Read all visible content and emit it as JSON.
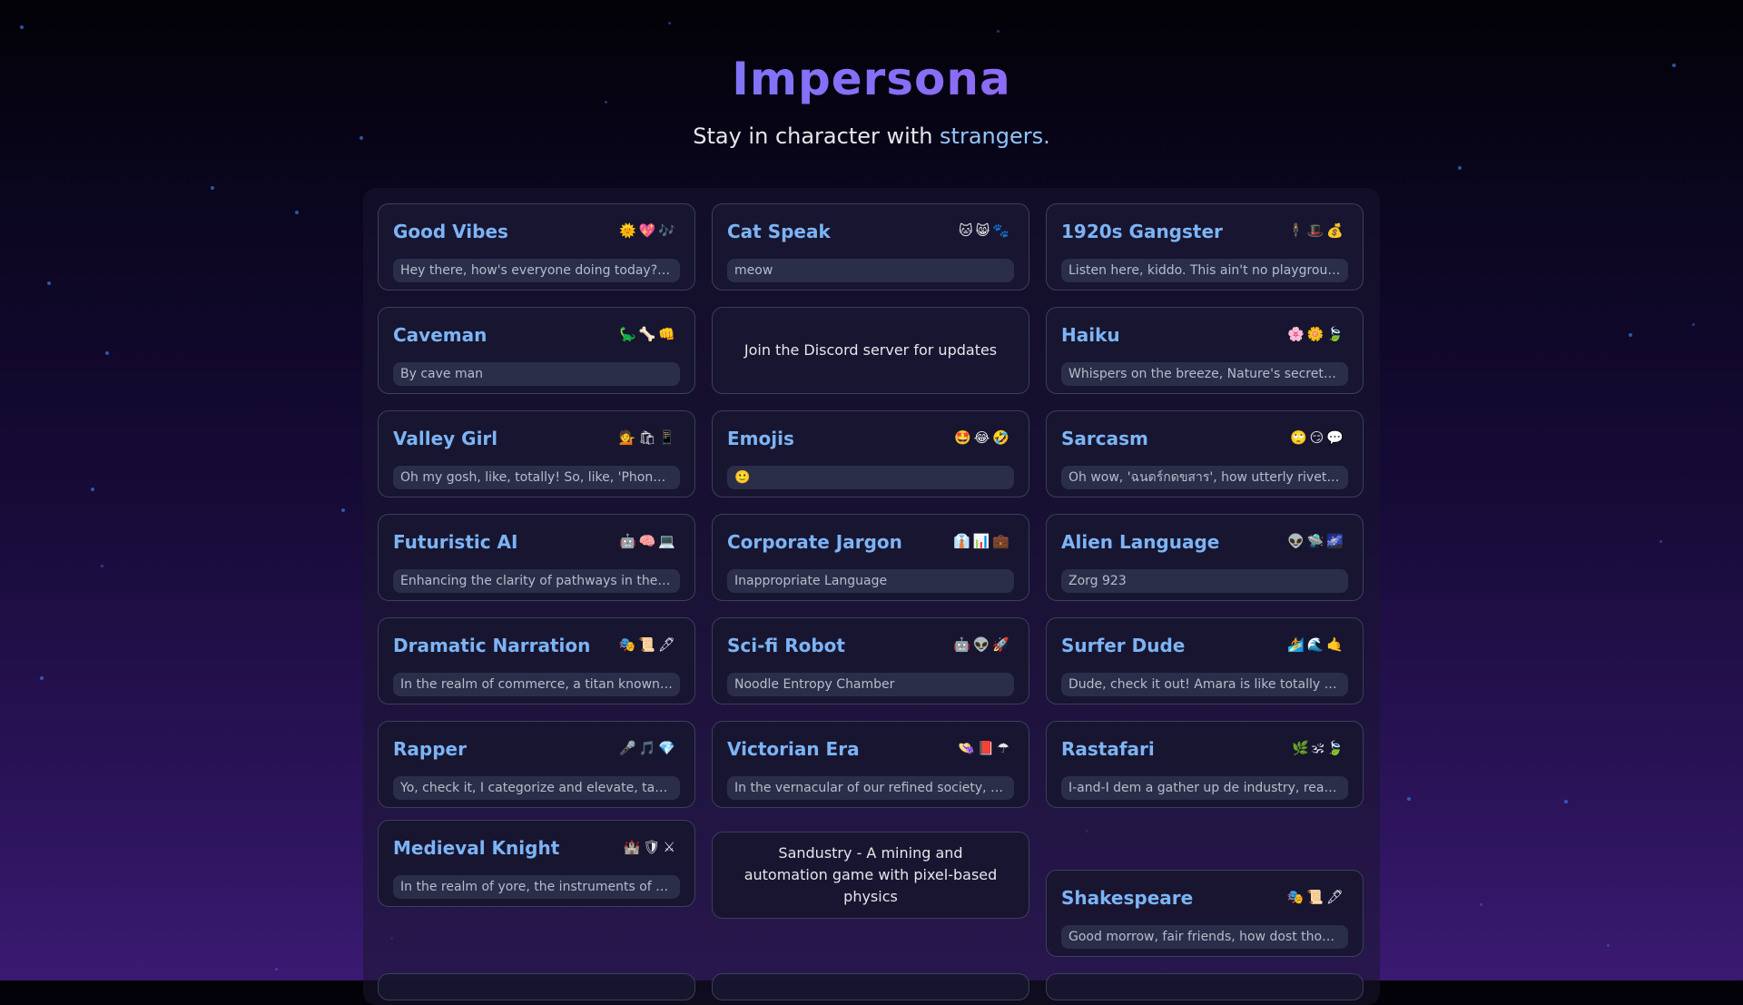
{
  "app": {
    "title": "Impersona",
    "subtitle_main": "Stay in character with ",
    "subtitle_accent": "strangers."
  },
  "cards": [
    {
      "title": "Good Vibes",
      "icons": "🌞💖🎶",
      "preview": "Hey there, how's everyone doing today? Se..."
    },
    {
      "title": "Cat Speak",
      "icons": "🐱😸🐾",
      "preview": "meow"
    },
    {
      "title": "1920s Gangster",
      "icons": "🕴🎩💰",
      "preview": "Listen here, kiddo. This ain't no playground;..."
    },
    {
      "title": "Caveman",
      "icons": "🦕🦴👊",
      "preview": "By cave man"
    },
    {
      "title": "Haiku",
      "icons": "🌸🌼🍃",
      "preview": "Whispers on the breeze, Nature's secrets s..."
    },
    {
      "title": "Valley Girl",
      "icons": "💁🛍📱",
      "preview": "Oh my gosh, like, totally! So, like, 'Phongph..."
    },
    {
      "title": "Emojis",
      "icons": "🤩😂🤣",
      "preview": "🙂"
    },
    {
      "title": "Sarcasm",
      "icons": "🙄😏💬",
      "preview": "Oh wow, 'ฉนดร์กดขสาร', how utterly riveting! ..."
    },
    {
      "title": "Futuristic AI",
      "icons": "🤖🧠💻",
      "preview": "Enhancing the clarity of pathways in the digi..."
    },
    {
      "title": "Corporate Jargon",
      "icons": "👔📊💼",
      "preview": "Inappropriate Language"
    },
    {
      "title": "Alien Language",
      "icons": "👽🛸🌌",
      "preview": "Zorg 923"
    },
    {
      "title": "Dramatic Narration",
      "icons": "🎭📜🖋",
      "preview": "In the realm of commerce, a titan known as ..."
    },
    {
      "title": "Sci-fi Robot",
      "icons": "🤖👽🚀",
      "preview": "Noodle Entropy Chamber"
    },
    {
      "title": "Surfer Dude",
      "icons": "🏄🌊🤙",
      "preview": "Dude, check it out! Amara is like totally rad, ..."
    },
    {
      "title": "Rapper",
      "icons": "🎤🎵💎",
      "preview": "Yo, check it, I categorize and elevate, takin..."
    },
    {
      "title": "Victorian Era",
      "icons": "👒📕☂",
      "preview": "In the vernacular of our refined society, suc..."
    },
    {
      "title": "Rastafari",
      "icons": "🌿🕉🍃",
      "preview": "I-and-I dem a gather up de industry, ready f..."
    },
    {
      "title": "Medieval Knight",
      "icons": "🏰🛡⚔",
      "preview": "In the realm of yore, the instruments of rene..."
    },
    {
      "title": "Shakespeare",
      "icons": "🎭📜🖋",
      "preview": "Good morrow, fair friends, how dost thou far..."
    }
  ],
  "promos": {
    "discord": "Join the Discord server for updates",
    "sandustry": "Sandustry - A mining and automation game with pixel-based physics"
  }
}
